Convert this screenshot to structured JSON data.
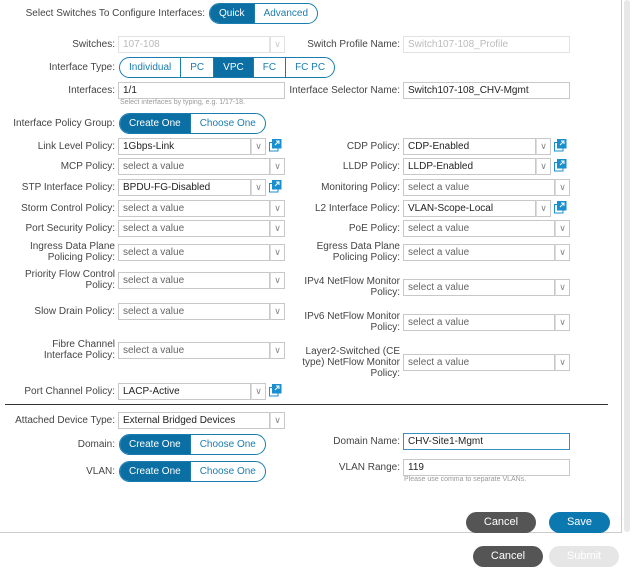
{
  "mode": {
    "label": "Select Switches To Configure Interfaces:",
    "options": [
      "Quick",
      "Advanced"
    ],
    "selected": "Quick"
  },
  "switches": {
    "label": "Switches:",
    "value": "107-108"
  },
  "switch_profile_name": {
    "label": "Switch Profile Name:",
    "value": "Switch107-108_Profile"
  },
  "interface_type": {
    "label": "Interface Type:",
    "options": [
      "Individual",
      "PC",
      "VPC",
      "FC",
      "FC PC"
    ],
    "selected": "VPC"
  },
  "interfaces": {
    "label": "Interfaces:",
    "value": "1/1",
    "hint": "Select interfaces by typing, e.g. 1/17-18."
  },
  "interface_selector_name": {
    "label": "Interface Selector Name:",
    "value": "Switch107-108_CHV-Mgmt"
  },
  "interface_policy_group": {
    "label": "Interface Policy Group:",
    "options": [
      "Create One",
      "Choose One"
    ],
    "selected": "Create One"
  },
  "left_policies": [
    {
      "label": "Link Level Policy:",
      "value": "1Gbps-Link",
      "placeholder": false,
      "copy": true
    },
    {
      "label": "MCP Policy:",
      "value": "select a value",
      "placeholder": true,
      "copy": false
    },
    {
      "label": "STP Interface Policy:",
      "value": "BPDU-FG-Disabled",
      "placeholder": false,
      "copy": true
    },
    {
      "label": "Storm Control Policy:",
      "value": "select a value",
      "placeholder": true,
      "copy": false
    },
    {
      "label": "Port Security Policy:",
      "value": "select a value",
      "placeholder": true,
      "copy": false
    },
    {
      "label": "Ingress Data Plane Policing Policy:",
      "value": "select a value",
      "placeholder": true,
      "copy": false
    },
    {
      "label": "Priority Flow Control Policy:",
      "value": "select a value",
      "placeholder": true,
      "copy": false
    },
    {
      "label": "Slow Drain Policy:",
      "value": "select a value",
      "placeholder": true,
      "copy": false
    },
    {
      "label": "Fibre Channel Interface Policy:",
      "value": "select a value",
      "placeholder": true,
      "copy": false
    },
    {
      "label": "Port Channel Policy:",
      "value": "LACP-Active",
      "placeholder": false,
      "copy": true
    }
  ],
  "right_policies": [
    {
      "label": "CDP Policy:",
      "value": "CDP-Enabled",
      "placeholder": false,
      "copy": true
    },
    {
      "label": "LLDP Policy:",
      "value": "LLDP-Enabled",
      "placeholder": false,
      "copy": true
    },
    {
      "label": "Monitoring Policy:",
      "value": "select a value",
      "placeholder": true,
      "copy": false
    },
    {
      "label": "L2 Interface Policy:",
      "value": "VLAN-Scope-Local",
      "placeholder": false,
      "copy": true
    },
    {
      "label": "PoE Policy:",
      "value": "select a value",
      "placeholder": true,
      "copy": false
    },
    {
      "label": "Egress Data Plane Policing Policy:",
      "value": "select a value",
      "placeholder": true,
      "copy": false
    },
    {
      "label": "IPv4 NetFlow Monitor Policy:",
      "value": "select a value",
      "placeholder": true,
      "copy": false
    },
    {
      "label": "IPv6 NetFlow Monitor Policy:",
      "value": "select a value",
      "placeholder": true,
      "copy": false
    },
    {
      "label": "Layer2-Switched (CE type) NetFlow Monitor Policy:",
      "value": "select a value",
      "placeholder": true,
      "copy": false
    }
  ],
  "attached_device_type": {
    "label": "Attached Device Type:",
    "value": "External Bridged Devices"
  },
  "domain": {
    "label": "Domain:",
    "options": [
      "Create One",
      "Choose One"
    ],
    "selected": "Create One"
  },
  "vlan": {
    "label": "VLAN:",
    "options": [
      "Create One",
      "Choose One"
    ],
    "selected": "Create One"
  },
  "domain_name": {
    "label": "Domain Name:",
    "value": "CHV-Site1-Mgmt"
  },
  "vlan_range": {
    "label": "VLAN Range:",
    "value": "119",
    "hint": "Please use comma to separate VLANs."
  },
  "inner_buttons": {
    "cancel": "Cancel",
    "save": "Save"
  },
  "footer_buttons": {
    "cancel": "Cancel",
    "submit": "Submit"
  },
  "colors": {
    "accent": "#0b6fa3",
    "dark_button": "#555555",
    "disabled_button": "#e6e6e6"
  }
}
